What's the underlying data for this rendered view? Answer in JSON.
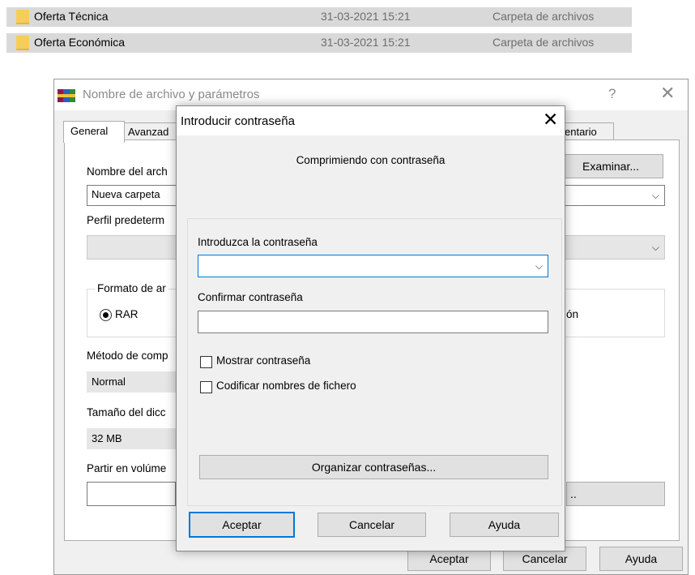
{
  "explorer": {
    "rows": [
      {
        "name": "Oferta Técnica",
        "date": "31-03-2021 15:21",
        "type": "Carpeta de archivos"
      },
      {
        "name": "Oferta Económica",
        "date": "31-03-2021 15:21",
        "type": "Carpeta de archivos"
      }
    ]
  },
  "archive_dialog": {
    "title": "Nombre de archivo y parámetros",
    "help": "?",
    "close": "✕",
    "tabs": [
      "General",
      "Avanzad",
      "entario"
    ],
    "browse_button": "Examinar...",
    "archive_name_label": "Nombre del arch",
    "archive_name_value": "Nueva carpeta",
    "profile_label": "Perfil predeterm",
    "format_group_label": "Formato de ar",
    "format_rar": "RAR",
    "partial_option_text": "ón",
    "method_label": "Método de comp",
    "method_value": "Normal",
    "dict_label": "Tamaño del dicc",
    "dict_value": "32 MB",
    "split_label": "Partir en volúme",
    "split_button_tail": "..",
    "ok": "Aceptar",
    "cancel": "Cancelar",
    "help_button": "Ayuda"
  },
  "password_dialog": {
    "title": "Introducir contraseña",
    "close": "✕",
    "subtitle": "Comprimiendo con contraseña",
    "enter_label": "Introduzca la contraseña",
    "enter_value": "",
    "confirm_label": "Confirmar contraseña",
    "confirm_value": "",
    "show_password": "Mostrar contraseña",
    "encrypt_names": "Codificar nombres de fichero",
    "organize_button": "Organizar contraseñas...",
    "ok": "Aceptar",
    "cancel": "Cancelar",
    "help": "Ayuda"
  },
  "colors": {
    "selection": "#d9d9d9",
    "folder": "#f6cd5a",
    "focus_blue": "#0078d7"
  }
}
